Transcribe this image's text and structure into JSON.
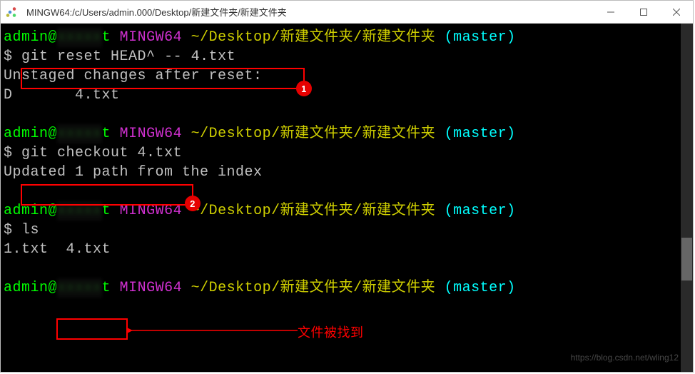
{
  "window": {
    "title": "MINGW64:/c/Users/admin.000/Desktop/新建文件夹/新建文件夹"
  },
  "prompt": {
    "user": "admin@",
    "host_masked": "xxxxx",
    "host_suffix": "t",
    "env": "MINGW64",
    "path": "~/Desktop/新建文件夹/新建文件夹",
    "branch": "(master)",
    "sigil": "$"
  },
  "block1": {
    "command": "git reset HEAD^ -- 4.txt",
    "out_line1": "Unstaged changes after reset:",
    "out_line2": "D       4.txt"
  },
  "block2": {
    "command": "git checkout 4.txt",
    "out_line1": "Updated 1 path from the index"
  },
  "block3": {
    "command": "ls",
    "out_file1": "1.txt",
    "out_file2": "4.txt"
  },
  "annotations": {
    "badge1": "1",
    "badge2": "2",
    "found_text": "文件被找到"
  },
  "watermark": "https://blog.csdn.net/wling12"
}
